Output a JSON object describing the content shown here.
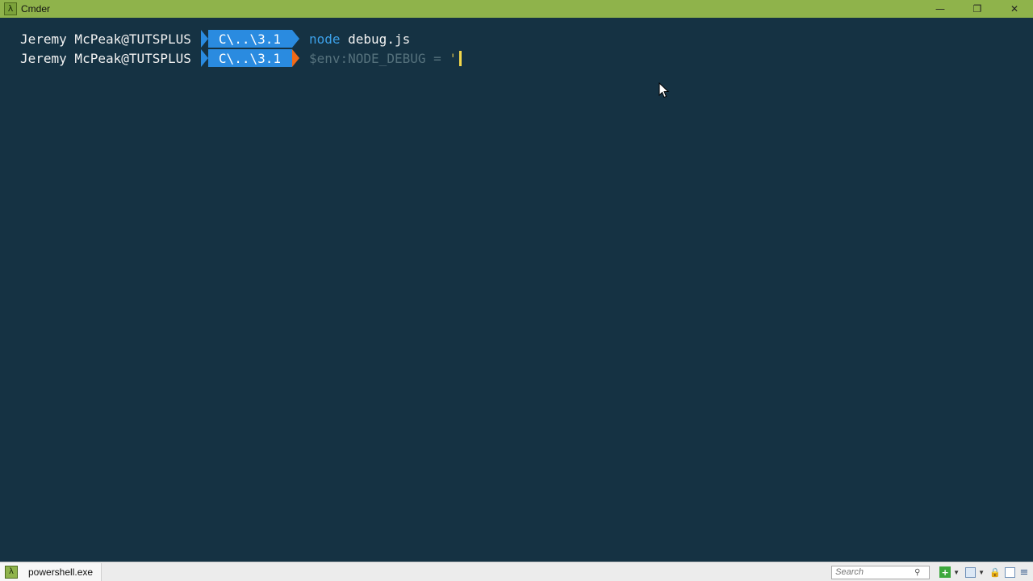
{
  "window": {
    "title": "Cmder",
    "app_icon": "lambda-icon",
    "app_icon_glyph": "λ",
    "controls": {
      "minimize": "—",
      "restore": "❐",
      "close": "✕"
    }
  },
  "terminal": {
    "lines": [
      {
        "user": "Jeremy McPeak@TUTSPLUS",
        "path": "C\\..\\3.1",
        "command_keyword": "node",
        "command_args": " debug.js"
      },
      {
        "user": "Jeremy McPeak@TUTSPLUS",
        "path": "C\\..\\3.1",
        "command_text": "$env:NODE_DEBUG = ",
        "quote": "'"
      }
    ]
  },
  "statusbar": {
    "tab_label": "powershell.exe",
    "tab_icon_glyph": "λ",
    "search_placeholder": "Search",
    "icons": [
      "plus-icon",
      "panel-icon",
      "lock-icon",
      "split-icon",
      "menu-icon"
    ]
  },
  "colors": {
    "titlebar": "#8fb34b",
    "terminal_bg": "#153243",
    "path_segment": "#2a8be0",
    "arrow_error": "#f06a18",
    "keyword": "#3ca0e8",
    "cursor": "#f2d64b"
  }
}
